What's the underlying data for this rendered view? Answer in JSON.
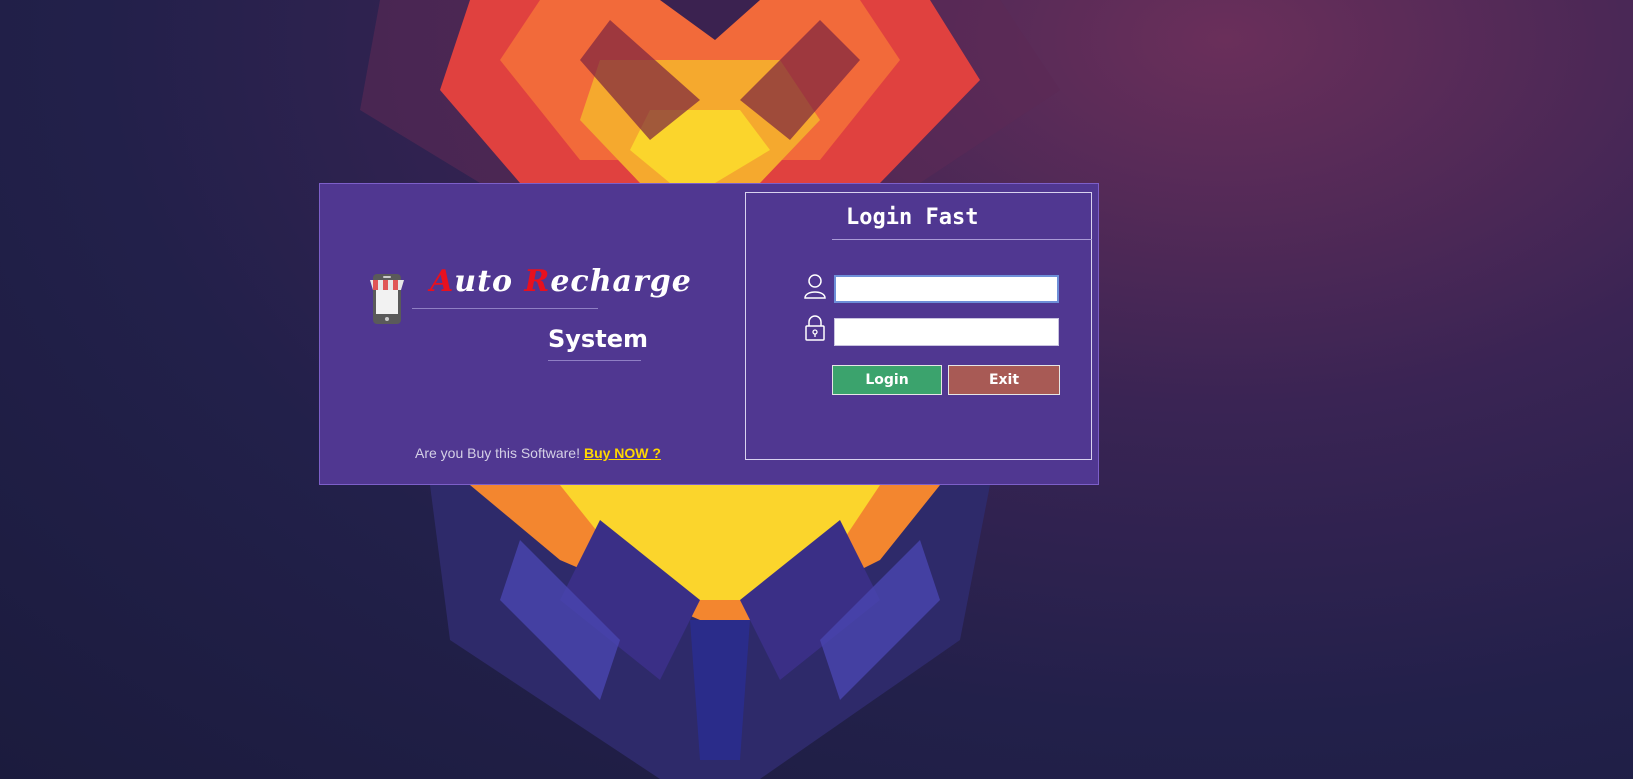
{
  "brand": {
    "title_initial_1": "A",
    "title_rest_1": "uto ",
    "title_initial_2": "R",
    "title_rest_2": "echarge",
    "subtitle": "System"
  },
  "footer": {
    "question": "Are you Buy this Software!",
    "buy_link": "Buy NOW ?"
  },
  "login": {
    "title": "Login Fast",
    "username_value": "",
    "password_value": "",
    "login_button": "Login",
    "exit_button": "Exit"
  },
  "icons": {
    "brand": "mobile-shop-icon",
    "username": "user-icon",
    "password": "lock-icon"
  },
  "colors": {
    "window_bg": "#503791",
    "accent_red": "#e8101e",
    "link_yellow": "#ffd700",
    "login_green": "#3ba36d",
    "exit_red": "#a85a55"
  }
}
